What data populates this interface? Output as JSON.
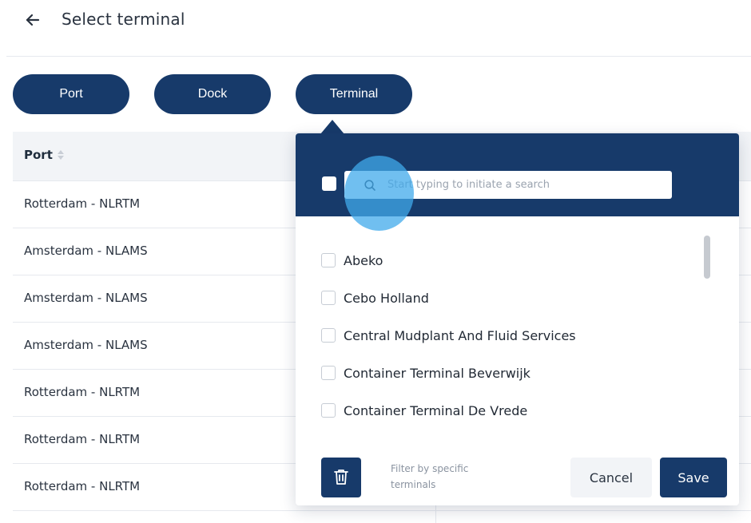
{
  "header": {
    "back_icon": "arrow-left-icon",
    "title": "Select terminal"
  },
  "filters": {
    "port_label": "Port",
    "dock_label": "Dock",
    "terminal_label": "Terminal"
  },
  "table": {
    "columns": [
      "Port"
    ],
    "rows": [
      "Rotterdam - NLRTM",
      "Amsterdam - NLAMS",
      "Amsterdam - NLAMS",
      "Amsterdam - NLAMS",
      "Rotterdam - NLRTM",
      "Rotterdam - NLRTM",
      "Rotterdam - NLRTM"
    ]
  },
  "dropdown": {
    "search_placeholder": "Start typing to initiate a search",
    "search_icon": "search-icon",
    "options": [
      "Abeko",
      "Cebo Holland",
      "Central Mudplant And Fluid Services",
      "Container Terminal Beverwijk",
      "Container Terminal De Vrede"
    ],
    "delete_icon": "trash-icon",
    "hint": "Filter by specific terminals",
    "cancel_label": "Cancel",
    "save_label": "Save"
  },
  "colors": {
    "primary": "#173a6a",
    "ripple": "#40aaeb",
    "header_bg": "#f2f4f7"
  }
}
